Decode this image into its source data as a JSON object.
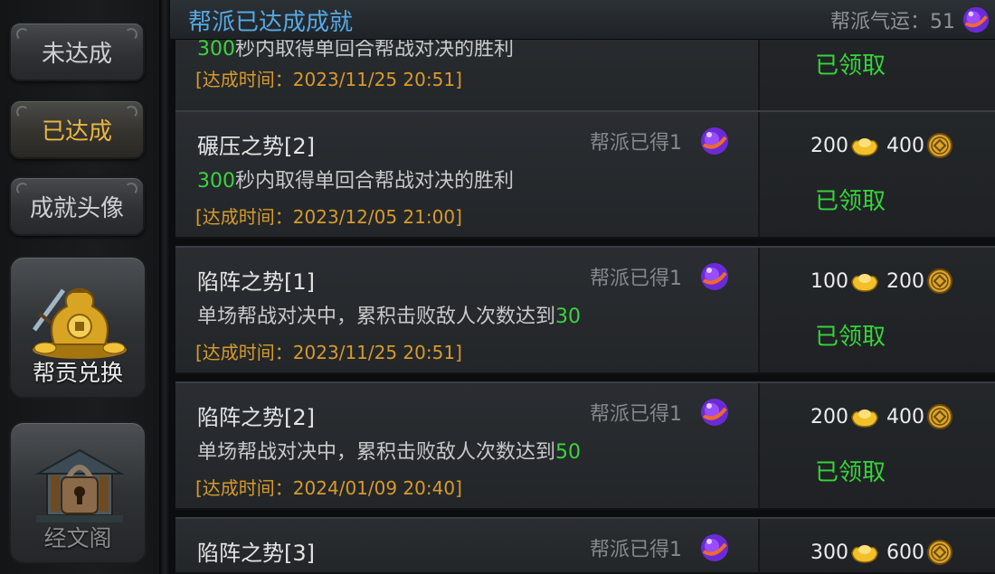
{
  "sidebar": {
    "tabs": [
      {
        "label": "未达成"
      },
      {
        "label": "已达成"
      },
      {
        "label": "成就头像"
      }
    ],
    "tiles": [
      {
        "label": "帮贡兑换",
        "icon": "gold-sack-icon"
      },
      {
        "label": "经文阁",
        "icon": "locked-pavilion-icon"
      }
    ]
  },
  "header": {
    "title": "帮派已达成成就",
    "luck_label": "帮派气运：51",
    "luck_icon": "purple-orb-icon"
  },
  "rows": [
    {
      "name": "",
      "desc_hl": "300",
      "desc_text": "秒内取得单回合帮战对决的胜利",
      "time": "[达成时间：2023/11/25  20:51]",
      "earn": "",
      "gold": "",
      "coin": "",
      "status": "已领取"
    },
    {
      "name": "碾压之势[2]",
      "desc_hl": "300",
      "desc_text": "秒内取得单回合帮战对决的胜利",
      "time": "[达成时间：2023/12/05  21:00]",
      "earn": "帮派已得1",
      "gold": "200",
      "coin": "400",
      "status": "已领取"
    },
    {
      "name": "陷阵之势[1]",
      "desc_text": "单场帮战对决中，累积击败敌人次数达到",
      "desc_hl": "30",
      "time": "[达成时间：2023/11/25  20:51]",
      "earn": "帮派已得1",
      "gold": "100",
      "coin": "200",
      "status": "已领取"
    },
    {
      "name": "陷阵之势[2]",
      "desc_text": "单场帮战对决中，累积击败敌人次数达到",
      "desc_hl": "50",
      "time": "[达成时间：2024/01/09  20:40]",
      "earn": "帮派已得1",
      "gold": "200",
      "coin": "400",
      "status": "已领取"
    },
    {
      "name": "陷阵之势[3]",
      "earn": "帮派已得1",
      "gold": "300",
      "coin": "600"
    }
  ],
  "colors": {
    "title_blue": "#56a9e4",
    "claimed_green": "#35d43a",
    "time_orange": "#d79a2b",
    "highlight_green": "#3cd33c"
  }
}
